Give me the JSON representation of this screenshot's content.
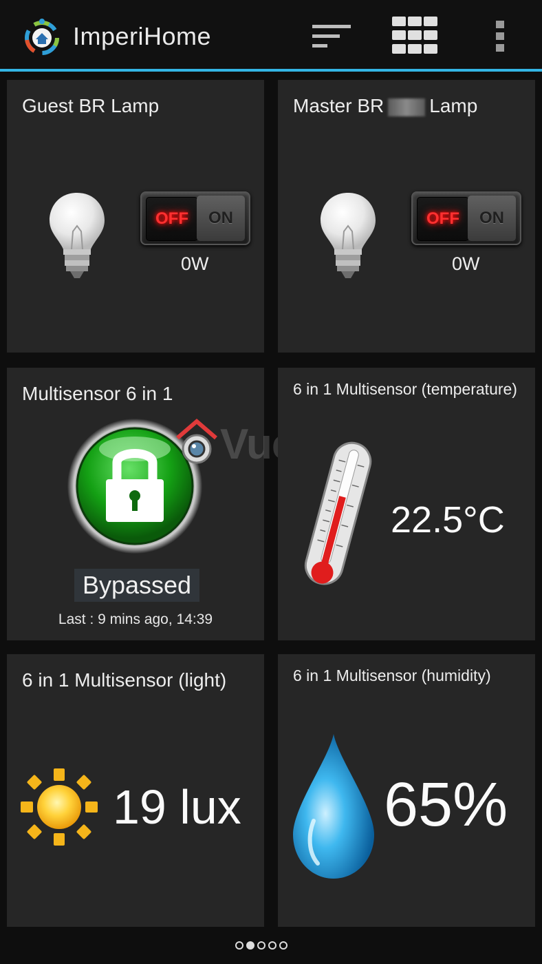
{
  "app": {
    "title": "ImperiHome",
    "icons": {
      "logo": "imperihome-logo-icon",
      "sort": "sort-lines-icon",
      "grid": "grid-view-icon",
      "overflow": "overflow-menu-icon"
    },
    "accent_color": "#33b5e5"
  },
  "tiles": [
    {
      "title": "Guest BR Lamp",
      "icon": "light-bulb-icon",
      "switch_state": "off",
      "off_label": "OFF",
      "on_label": "ON",
      "power": "0W"
    },
    {
      "title_left": "Master BR",
      "title_right": "Lamp",
      "icon": "light-bulb-icon",
      "switch_state": "off",
      "off_label": "OFF",
      "on_label": "ON",
      "power": "0W"
    },
    {
      "title": "Multisensor 6 in 1",
      "icon": "padlock-icon",
      "status": "Bypassed",
      "last_update": "Last : 9 mins ago, 14:39",
      "status_color": "#1fa81f"
    },
    {
      "title": "6 in 1 Multisensor (temperature)",
      "icon": "thermometer-icon",
      "value": "22.5°C"
    },
    {
      "title": "6 in 1 Multisensor (light)",
      "icon": "sun-icon",
      "value": "19 lux"
    },
    {
      "title": "6 in 1 Multisensor (humidity)",
      "icon": "water-drop-icon",
      "value": "65%"
    }
  ],
  "watermark": "VueVille",
  "pager": {
    "total": 5,
    "current": 2
  }
}
